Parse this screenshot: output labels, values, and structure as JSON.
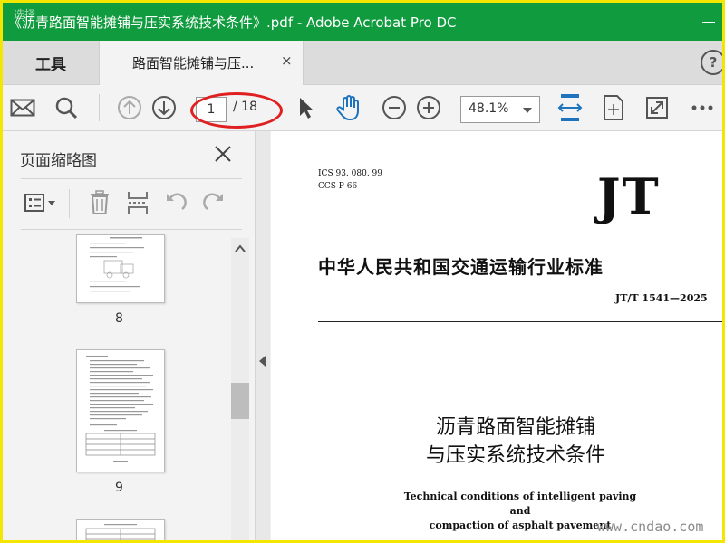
{
  "window": {
    "title": "《沥青路面智能摊铺与压实系统技术条件》.pdf - Adobe Acrobat Pro DC",
    "watermark": "选择",
    "bar_color": "#0f9b3e"
  },
  "tabs": {
    "tools_label": "工具",
    "document_label": "路面智能摊铺与压...",
    "close_glyph": "×",
    "help_glyph": "?"
  },
  "toolbar": {
    "current_page": "1",
    "total_pages": "/ 18",
    "zoom": "48.1%",
    "accent_color": "#1e73be",
    "highlight_color": "#e02020"
  },
  "left_panel": {
    "title": "页面缩略图",
    "thumbnails": [
      {
        "page": "8"
      },
      {
        "page": "9"
      }
    ]
  },
  "document": {
    "ics": "ICS 93. 080. 99",
    "ccs": "CCS P 66",
    "logo": "JT",
    "heading": "中华人民共和国交通运输行业标准",
    "code": "JT/T 1541—2025",
    "title_line1": "沥青路面智能摊铺",
    "title_line2": "与压实系统技术条件",
    "en_line1": "Technical conditions of intelligent paving and",
    "en_line2": "compaction of asphalt pavement",
    "site_watermark": "www.cndao.com"
  }
}
